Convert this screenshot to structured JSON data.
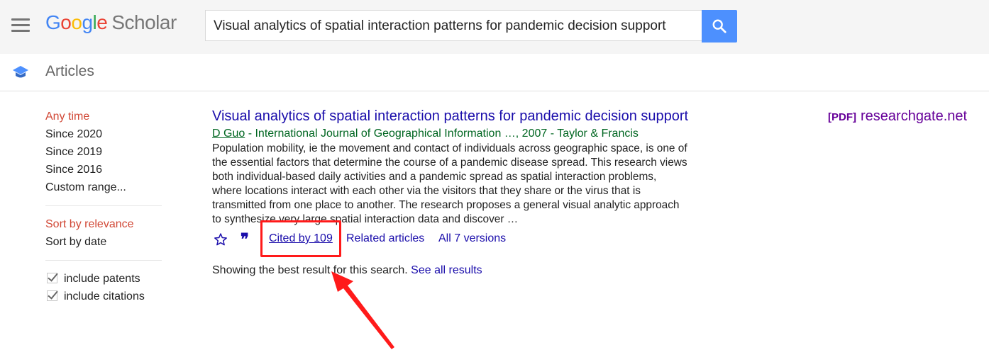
{
  "header": {
    "logo_letters": [
      "G",
      "o",
      "o",
      "g",
      "l",
      "e"
    ],
    "logo_scholar": "Scholar",
    "search_value": "Visual analytics of spatial interaction patterns for pandemic decision support",
    "search_icon": "search-icon",
    "menu_icon": "menu-icon"
  },
  "articles_bar": {
    "icon": "graduation-cap-icon",
    "title": "Articles"
  },
  "sidebar": {
    "time_filters": [
      "Any time",
      "Since 2020",
      "Since 2019",
      "Since 2016",
      "Custom range..."
    ],
    "active_time": "Any time",
    "sort_options": [
      "Sort by relevance",
      "Sort by date"
    ],
    "active_sort": "Sort by relevance",
    "checkboxes": [
      {
        "label": "include patents",
        "checked": true
      },
      {
        "label": "include citations",
        "checked": true
      }
    ]
  },
  "result": {
    "title": "Visual analytics of spatial interaction patterns for pandemic decision support",
    "author": "D Guo",
    "meta_rest": " - International Journal of Geographical Information …, 2007 - Taylor & Francis",
    "snippet": "Population mobility, ie the movement and contact of individuals across geographic space, is one of the essential factors that determine the course of a pandemic disease spread. This research views both individual-based daily activities and a pandemic spread as spatial interaction problems, where locations interact with each other via the visitors that they share or the virus that is transmitted from one place to another. The research proposes a general visual analytic approach to synthesize very large spatial interaction data and discover …",
    "actions": {
      "save_icon": "star-icon",
      "cite_icon": "quote-icon",
      "cited_by": "Cited by 109",
      "related": "Related articles",
      "versions": "All 7 versions"
    },
    "pdf_tag": "[PDF]",
    "pdf_source": "researchgate.net"
  },
  "footer_note": {
    "text": "Showing the best result for this search.",
    "link": "See all results"
  },
  "colors": {
    "link": "#1a0dab",
    "meta_green": "#006621",
    "active_red": "#d14836",
    "search_blue": "#4d90fe",
    "pdf_purple": "#660099",
    "annotation_red": "#ff1a1a"
  }
}
